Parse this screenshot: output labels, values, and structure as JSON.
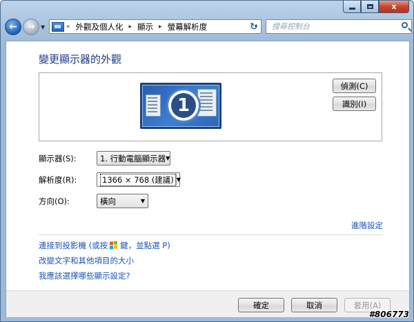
{
  "window": {
    "caption": {
      "minimize": "minimize",
      "maximize": "maximize",
      "close": "x"
    }
  },
  "nav": {
    "back_icon": "back-arrow-icon",
    "forward_icon": "forward-arrow-icon",
    "address": {
      "prefix": "«",
      "segments": [
        "外觀及個人化",
        "顯示",
        "螢幕解析度"
      ],
      "separator": "▸",
      "dropdown": "▾"
    },
    "refresh": "↻",
    "search": {
      "placeholder": "搜尋控制台"
    }
  },
  "main": {
    "title": "變更顯示器的外觀",
    "preview": {
      "monitor_number": "1",
      "detect_button": "偵測(C)",
      "identify_button": "識別(I)"
    },
    "fields": [
      {
        "label": "顯示器(S):",
        "value": "1. 行動電腦顯示器"
      },
      {
        "label": "解析度(R):",
        "value": "1366 × 768 (建議)"
      },
      {
        "label": "方向(O):",
        "value": "橫向"
      }
    ],
    "advanced_link": "進階設定",
    "links": {
      "projector_pre": "連接到投影機 (或按",
      "projector_post": "鍵，並點選 P)",
      "text_size": "改變文字和其他項目的大小",
      "which_settings": "我應該選擇哪些顯示設定?"
    }
  },
  "footer": {
    "ok": "確定",
    "cancel": "取消",
    "apply": "套用(A)"
  },
  "watermark": "#806773",
  "colors": {
    "title_blue": "#1e3b8a",
    "link_blue": "#1a52b8",
    "frame_blue": "#9fbad8"
  }
}
